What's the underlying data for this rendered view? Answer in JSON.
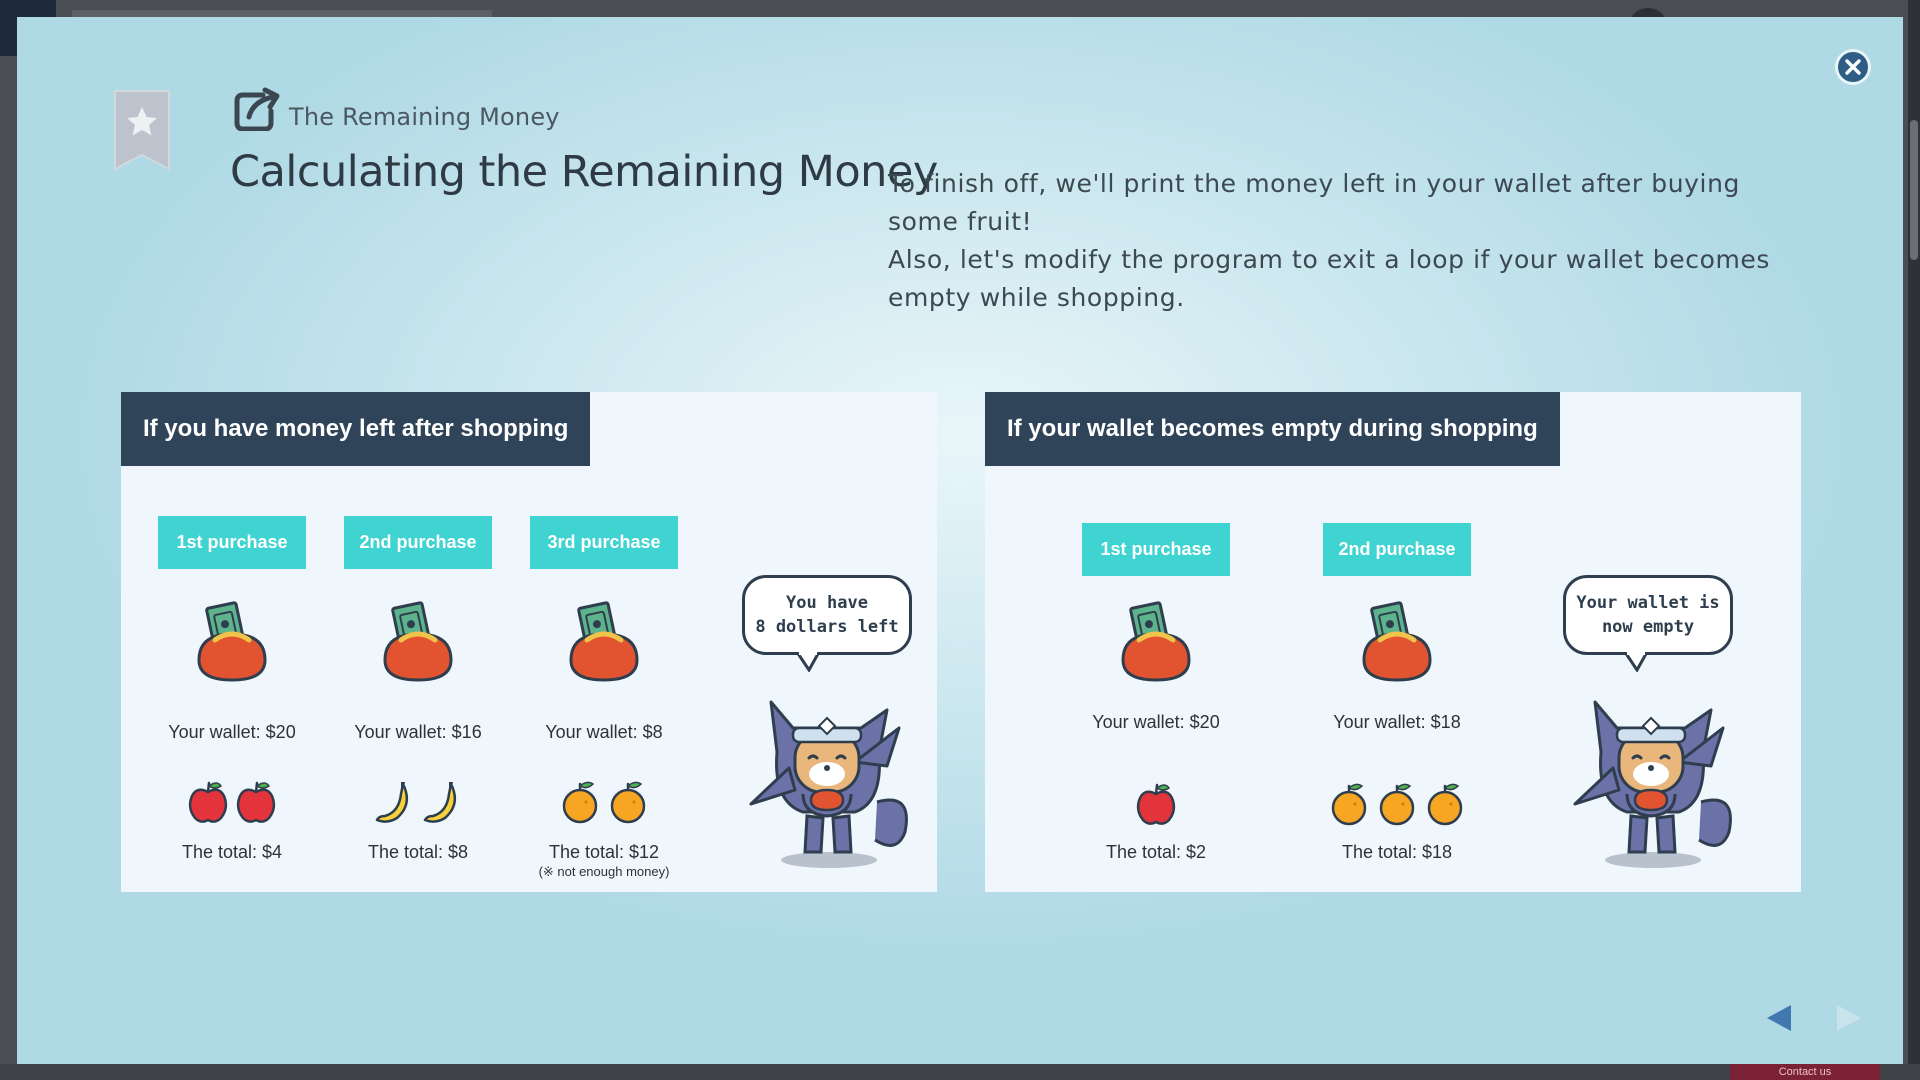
{
  "background": {
    "contact_label": "Contact us"
  },
  "modal": {
    "lesson_name": "The Remaining Money",
    "title": "Calculating the Remaining Money",
    "intro_lines": [
      "To finish off, we'll print the money left in your wallet after buying some fruit!",
      "Also, let's modify the program to exit a loop if your wallet becomes empty while shopping."
    ],
    "icons": {
      "close": "close-icon",
      "bookmark": "bookmark-star-icon",
      "lesson": "external-link-icon",
      "prev": "arrow-left-icon",
      "next": "arrow-right-icon"
    },
    "colors": {
      "panel_heading_bg": "#2f4359",
      "badge_bg": "#3fd3d2",
      "wallet_red": "#e2542f",
      "nav_arrow": "#3f79b0"
    }
  },
  "panels": [
    {
      "heading": "If you have money left after shopping",
      "purchases": [
        {
          "label": "1st purchase",
          "wallet": "Your wallet: $20",
          "fruit": "apple",
          "count": 2,
          "total": "The total: $4",
          "note": ""
        },
        {
          "label": "2nd purchase",
          "wallet": "Your wallet: $16",
          "fruit": "banana",
          "count": 2,
          "total": "The total: $8",
          "note": ""
        },
        {
          "label": "3rd purchase",
          "wallet": "Your wallet: $8",
          "fruit": "orange",
          "count": 2,
          "total": "The total: $12",
          "note": "(※ not enough money)"
        }
      ],
      "bubble": [
        "You have",
        "8 dollars left"
      ]
    },
    {
      "heading": "If your wallet becomes empty during shopping",
      "purchases": [
        {
          "label": "1st purchase",
          "wallet": "Your wallet: $20",
          "fruit": "apple",
          "count": 1,
          "total": "The total: $2",
          "note": ""
        },
        {
          "label": "2nd purchase",
          "wallet": "Your wallet: $18",
          "fruit": "orange",
          "count": 3,
          "total": "The total: $18",
          "note": ""
        }
      ],
      "bubble": [
        "Your wallet is",
        "now empty"
      ]
    }
  ]
}
